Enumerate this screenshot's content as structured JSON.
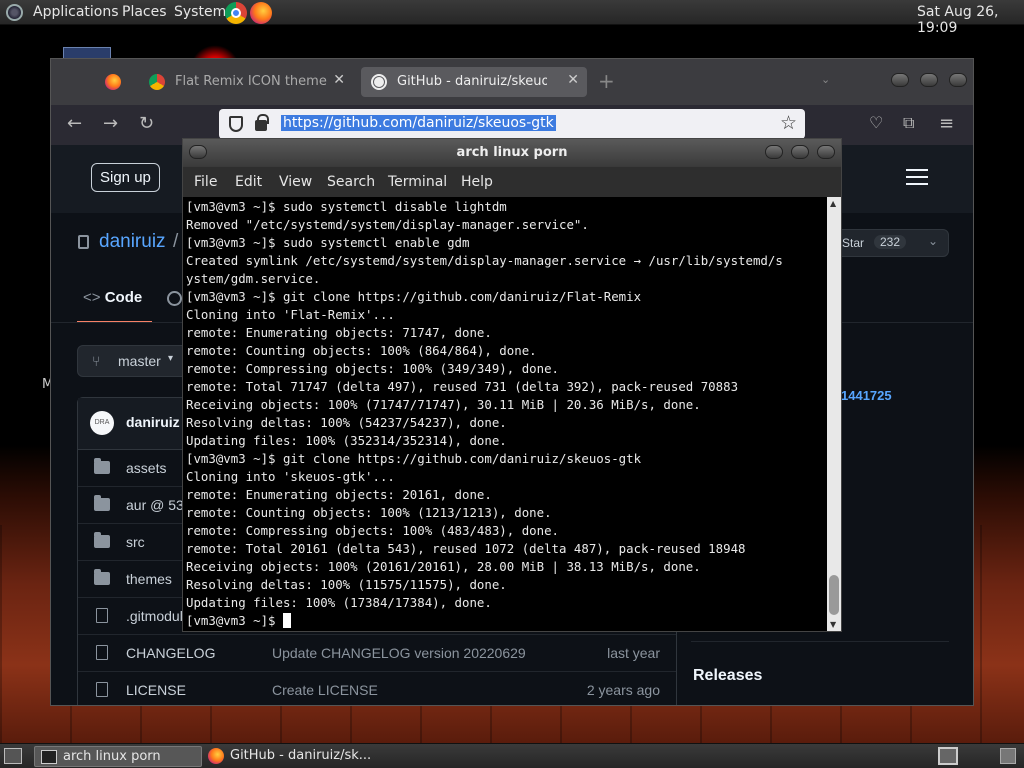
{
  "top_panel": {
    "menus": [
      "Applications",
      "Places",
      "System"
    ],
    "clock": "Sat Aug 26, 19:09"
  },
  "browser": {
    "tabs": [
      {
        "label": "",
        "icon": "firefox-icon"
      },
      {
        "label": "Flat Remix ICON theme",
        "icon": "chromium-icon"
      },
      {
        "label": "GitHub - daniruiz/skeuos-gtk",
        "icon": "github-icon"
      }
    ],
    "new_tab": "+",
    "url": "https://github.com/daniruiz/skeuos-gtk"
  },
  "github": {
    "signup": "Sign up",
    "owner": "daniruiz",
    "slash": "/",
    "star_label": "Star",
    "star_count": "232",
    "code_tab": "Code",
    "branch": "master",
    "commit_author": "daniruiz",
    "avatar_text": "DRA",
    "side_link": "1441725",
    "releases": "Releases",
    "files": [
      {
        "name": "assets",
        "type": "folder",
        "message": "",
        "age": ""
      },
      {
        "name": "aur @ 53",
        "type": "submodule",
        "message": "",
        "age": ""
      },
      {
        "name": "src",
        "type": "folder",
        "message": "",
        "age": ""
      },
      {
        "name": "themes",
        "type": "folder",
        "message": "",
        "age": ""
      },
      {
        "name": ".gitmodul",
        "type": "file",
        "message": "",
        "age": ""
      },
      {
        "name": "CHANGELOG",
        "type": "file",
        "message": "Update CHANGELOG version 20220629",
        "age": "last year"
      },
      {
        "name": "LICENSE",
        "type": "file",
        "message": "Create LICENSE",
        "age": "2 years ago"
      }
    ]
  },
  "terminal": {
    "title": "arch linux porn",
    "menu": [
      "File",
      "Edit",
      "View",
      "Search",
      "Terminal",
      "Help"
    ],
    "lines": [
      "[vm3@vm3 ~]$ sudo systemctl disable lightdm",
      "Removed \"/etc/systemd/system/display-manager.service\".",
      "[vm3@vm3 ~]$ sudo systemctl enable gdm",
      "Created symlink /etc/systemd/system/display-manager.service → /usr/lib/systemd/s",
      "ystem/gdm.service.",
      "[vm3@vm3 ~]$ git clone https://github.com/daniruiz/Flat-Remix",
      "Cloning into 'Flat-Remix'...",
      "remote: Enumerating objects: 71747, done.",
      "remote: Counting objects: 100% (864/864), done.",
      "remote: Compressing objects: 100% (349/349), done.",
      "remote: Total 71747 (delta 497), reused 731 (delta 392), pack-reused 70883",
      "Receiving objects: 100% (71747/71747), 30.11 MiB | 20.36 MiB/s, done.",
      "Resolving deltas: 100% (54237/54237), done.",
      "Updating files: 100% (352314/352314), done.",
      "[vm3@vm3 ~]$ git clone https://github.com/daniruiz/skeuos-gtk",
      "Cloning into 'skeuos-gtk'...",
      "remote: Enumerating objects: 20161, done.",
      "remote: Counting objects: 100% (1213/1213), done.",
      "remote: Compressing objects: 100% (483/483), done.",
      "remote: Total 20161 (delta 543), reused 1072 (delta 487), pack-reused 18948",
      "Receiving objects: 100% (20161/20161), 28.00 MiB | 38.13 MiB/s, done.",
      "Resolving deltas: 100% (11575/11575), done.",
      "Updating files: 100% (17384/17384), done."
    ],
    "prompt": "[vm3@vm3 ~]$ "
  },
  "taskbar": {
    "items": [
      {
        "label": "arch linux porn",
        "icon": "terminal-icon"
      },
      {
        "label": "GitHub - daniruiz/sk...",
        "icon": "firefox-icon"
      }
    ]
  },
  "desktop": {
    "partial_label": "M"
  }
}
